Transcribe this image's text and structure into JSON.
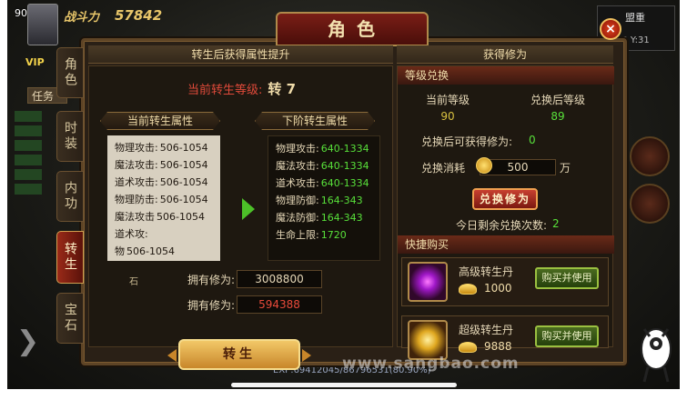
{
  "hud": {
    "level": "90",
    "power_label": "战斗力",
    "power_value": "57842",
    "vip": "VIP",
    "task": "任务",
    "minimap_name": "盟重",
    "minimap_coord": "52 Y:31",
    "exp": "EXP:69412045/86796531(80.90%)",
    "watermark": "www.sangbao.com"
  },
  "panel": {
    "title": "角色",
    "close_label": "×",
    "tabs": [
      {
        "label": "角色",
        "active": false
      },
      {
        "label": "时装",
        "active": false
      },
      {
        "label": "内功",
        "active": false
      },
      {
        "label": "转生",
        "active": true
      },
      {
        "label": "宝石",
        "active": false
      }
    ]
  },
  "left": {
    "header": "转生后获得属性提升",
    "cur_level_label": "当前转生等级:",
    "cur_level_value": "转 7",
    "current_title": "当前转生属性",
    "next_title": "下阶转生属性",
    "current_attrs": [
      {
        "name": "物理攻击:",
        "value": "506-1054"
      },
      {
        "name": "魔法攻击:",
        "value": "506-1054"
      },
      {
        "name": "道术攻击:",
        "value": "506-1054"
      },
      {
        "name": "物理防击:",
        "value": "506-1054"
      },
      {
        "name": "魔法攻击",
        "value": "506-1054"
      },
      {
        "name": "道术攻:",
        "value": ""
      },
      {
        "name": "物",
        "value": "506-1054"
      }
    ],
    "next_attrs": [
      {
        "name": "物理攻击:",
        "value": "640-1334"
      },
      {
        "name": "魔法攻击:",
        "value": "640-1334"
      },
      {
        "name": "道术攻击:",
        "value": "640-1334"
      },
      {
        "name": "物理防御:",
        "value": "164-343"
      },
      {
        "name": "魔法防御:",
        "value": "164-343"
      },
      {
        "name": "生命上限:",
        "value": "1720"
      }
    ],
    "stone_label": "石",
    "need_label": "拥有修为:",
    "need_value": "3008800",
    "own_label": "拥有修为:",
    "own_value": "594388",
    "rebirth_btn": "转生"
  },
  "right": {
    "header": "获得修为",
    "exchange_head": "等级兑换",
    "cur_level_label": "当前等级",
    "after_level_label": "兑换后等级",
    "cur_level": "90",
    "after_level": "89",
    "gain_label": "兑换后可获得修为:",
    "gain_value": "0",
    "cost_label": "兑换消耗",
    "cost_value": "500",
    "cost_unit": "万",
    "exchange_btn": "兑换修为",
    "remain_label": "今日剩余兑换次数:",
    "remain_value": "2",
    "quick_head": "快捷购买",
    "shop": [
      {
        "name": "高级转生丹",
        "price": "1000",
        "buy": "购买并使用",
        "icon": "purple-pill-icon"
      },
      {
        "name": "超级转生丹",
        "price": "9888",
        "buy": "购买并使用",
        "icon": "gold-pill-icon"
      }
    ]
  }
}
